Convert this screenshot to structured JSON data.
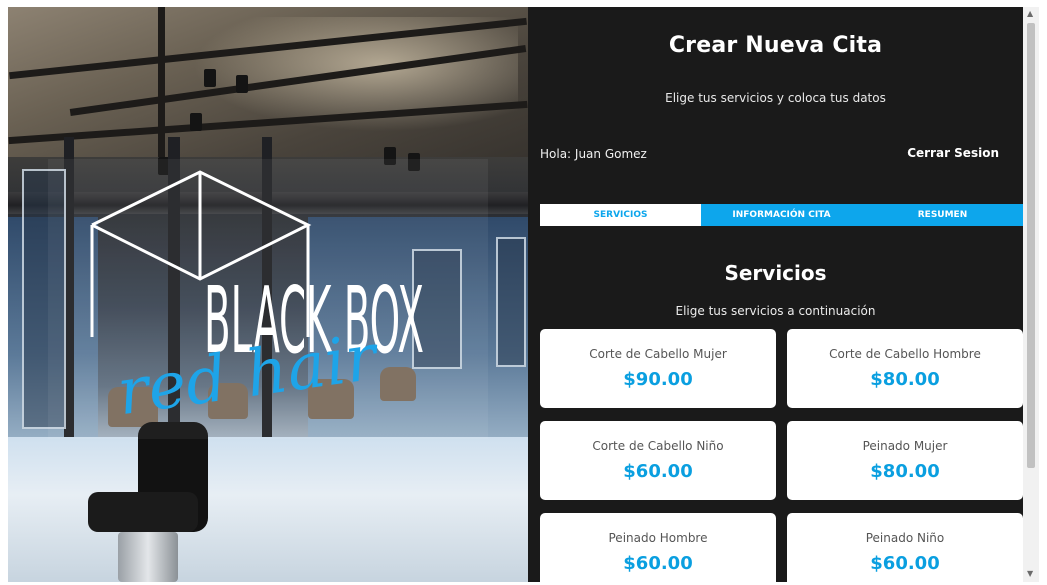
{
  "hero": {
    "logo_main": "BLACK BOX",
    "logo_script": "red hair"
  },
  "panel": {
    "title": "Crear Nueva Cita",
    "subtitle": "Elige tus servicios y coloca tus datos",
    "greeting": "Hola: Juan Gomez",
    "logout_label": "Cerrar Sesion"
  },
  "tabs": [
    {
      "label": "Servicios",
      "active": true
    },
    {
      "label": "Información Cita",
      "active": false
    },
    {
      "label": "Resumen",
      "active": false
    }
  ],
  "services_section": {
    "title": "Servicios",
    "subtitle": "Elige tus servicios a continuación"
  },
  "services": [
    {
      "name": "Corte de Cabello Mujer",
      "price": "$90.00"
    },
    {
      "name": "Corte de Cabello Hombre",
      "price": "$80.00"
    },
    {
      "name": "Corte de Cabello Niño",
      "price": "$60.00"
    },
    {
      "name": "Peinado Mujer",
      "price": "$80.00"
    },
    {
      "name": "Peinado Hombre",
      "price": "$60.00"
    },
    {
      "name": "Peinado Niño",
      "price": "$60.00"
    }
  ],
  "colors": {
    "accent": "#0da6ec",
    "panel_bg": "#1a1a1a",
    "price": "#0a9fe0"
  },
  "icons": {
    "scroll_up": "▲",
    "scroll_down": "▼"
  }
}
